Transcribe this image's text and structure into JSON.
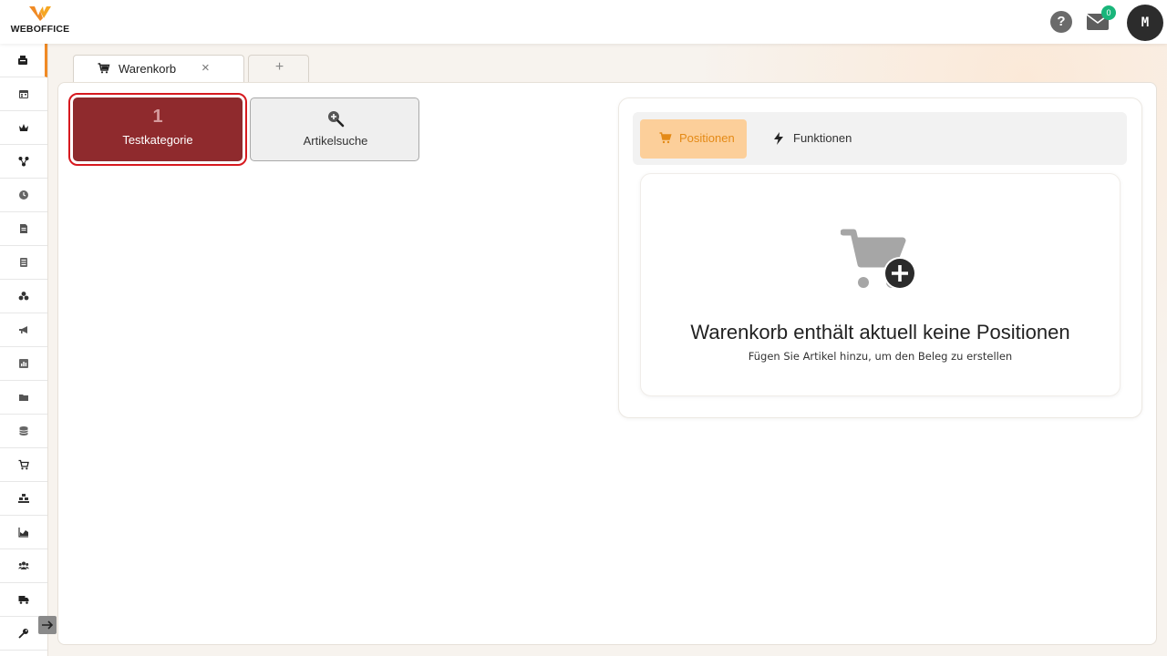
{
  "header": {
    "logo_text": "WEBOFFICE",
    "help_label": "?",
    "mail_badge_count": "0",
    "avatar_initial": "M"
  },
  "sidebar": {
    "items": [
      {
        "icon": "cash-register-icon"
      },
      {
        "icon": "calendar-icon"
      },
      {
        "icon": "crown-icon"
      },
      {
        "icon": "network-icon"
      },
      {
        "icon": "clock-icon"
      },
      {
        "icon": "document-icon"
      },
      {
        "icon": "list-icon"
      },
      {
        "icon": "boxes-icon"
      },
      {
        "icon": "megaphone-icon"
      },
      {
        "icon": "chart-icon"
      },
      {
        "icon": "folder-icon"
      },
      {
        "icon": "database-icon"
      },
      {
        "icon": "cart-icon"
      },
      {
        "icon": "warehouse-icon"
      },
      {
        "icon": "area-chart-icon"
      },
      {
        "icon": "users-icon"
      },
      {
        "icon": "truck-icon"
      },
      {
        "icon": "key-icon"
      }
    ],
    "active_index": 0
  },
  "tabs": [
    {
      "label": "Warenkorb",
      "close": "×"
    },
    {
      "label": "+"
    }
  ],
  "categories": [
    {
      "count": "1",
      "label": "Testkategorie"
    }
  ],
  "article_search": {
    "label": "Artikelsuche"
  },
  "cart": {
    "tabs": [
      {
        "label": "Positionen",
        "active": true
      },
      {
        "label": "Funktionen",
        "active": false
      }
    ],
    "empty_title": "Warenkorb enthält aktuell keine Positionen",
    "empty_subtitle": "Fügen Sie Artikel hinzu, um den Beleg zu erstellen"
  },
  "colors": {
    "accent": "#f08a24",
    "category_tile": "#8f2a2d",
    "selection_outline": "#d7191f",
    "active_tab": "#fccf9a",
    "badge": "#19b57a"
  }
}
